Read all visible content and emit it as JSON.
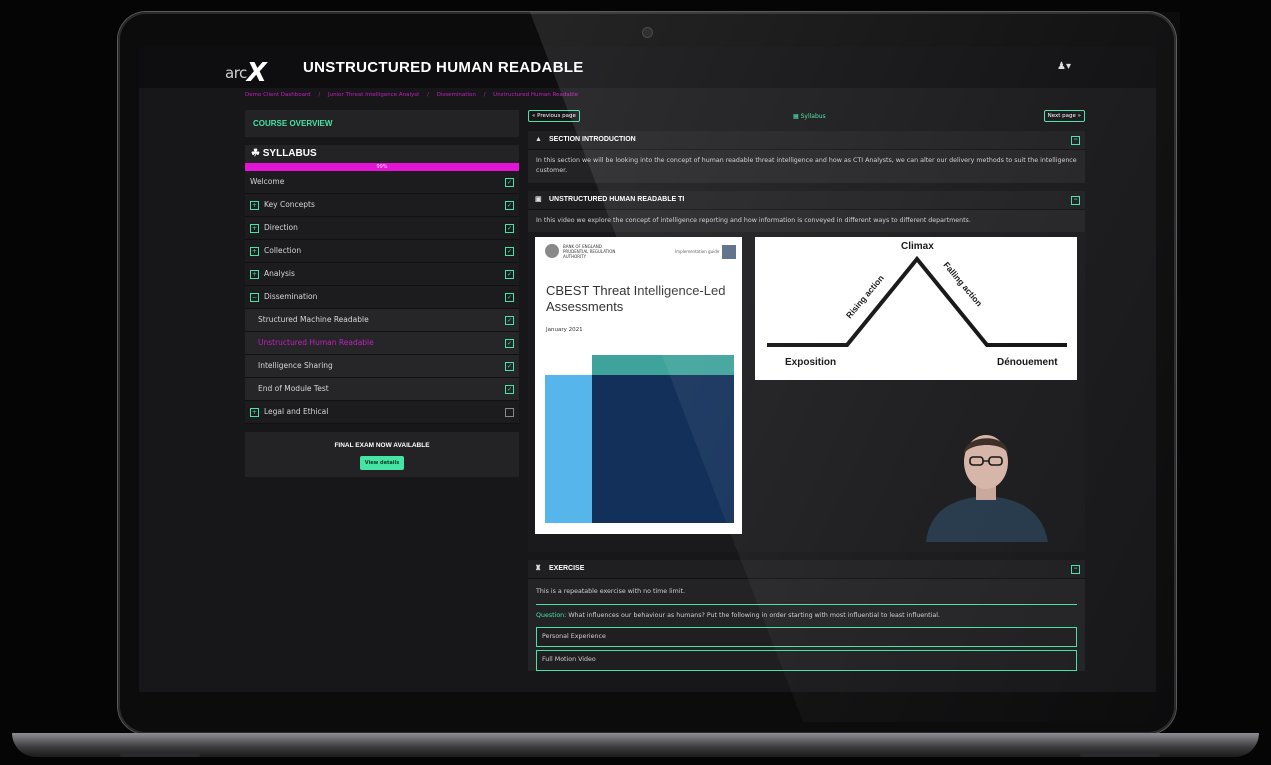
{
  "header": {
    "logo_prefix": "arc",
    "logo_mark": "X",
    "title": "UNSTRUCTURED HUMAN READABLE",
    "user_menu": "▾"
  },
  "breadcrumb": [
    "Demo Client Dashboard",
    "/",
    "Junior Threat Intelligence Analyst",
    "/",
    "Dissemination",
    "/",
    "Unstructured Human Readable"
  ],
  "sidebar": {
    "overview_label": "COURSE OVERVIEW",
    "syllabus_label": "SYLLABUS",
    "progress_text": "99%",
    "items": [
      {
        "label": "Welcome"
      },
      {
        "label": "Key Concepts"
      },
      {
        "label": "Direction"
      },
      {
        "label": "Collection"
      },
      {
        "label": "Analysis"
      },
      {
        "label": "Dissemination"
      },
      {
        "label": "Structured Machine Readable"
      },
      {
        "label": "Unstructured Human Readable"
      },
      {
        "label": "Intelligence Sharing"
      },
      {
        "label": "End of Module Test"
      },
      {
        "label": "Legal and Ethical"
      }
    ],
    "final_exam_title": "FINAL EXAM NOW AVAILABLE",
    "final_exam_button": "View details"
  },
  "nav": {
    "prev": "« Previous page",
    "syllabus": "Syllabus",
    "next": "Next page »"
  },
  "sections": {
    "intro_title": "SECTION INTRODUCTION",
    "intro_text": "In this section we will be looking into the concept of human readable threat intelligence and how as CTI Analysts, we can alter our delivery methods to suit the intelligence customer.",
    "video_title": "UNSTRUCTURED HUMAN READABLE TI",
    "video_text": "In this video we explore the concept of intelligence reporting and how information is conveyed in different ways to different departments.",
    "exercise_title": "EXERCISE",
    "exercise_text": "This is a repeatable exercise with no time limit.",
    "question_label": "Question:",
    "question_text": "What influences our behaviour as humans? Put the following in order starting with most influential to least influential.",
    "options": [
      "Personal Experience",
      "Full Motion Video"
    ]
  },
  "video_slide": {
    "doc_org_line1": "BANK OF ENGLAND",
    "doc_org_line2": "PRUDENTIAL REGULATION",
    "doc_org_line3": "AUTHORITY",
    "doc_guide": "Implementation guide",
    "doc_title": "CBEST Threat Intelligence-Led Assessments",
    "doc_date": "January 2021",
    "story_climax": "Climax",
    "story_rising": "Rising action",
    "story_falling": "Falling action",
    "story_exposition": "Exposition",
    "story_denouement": "Dénouement"
  }
}
